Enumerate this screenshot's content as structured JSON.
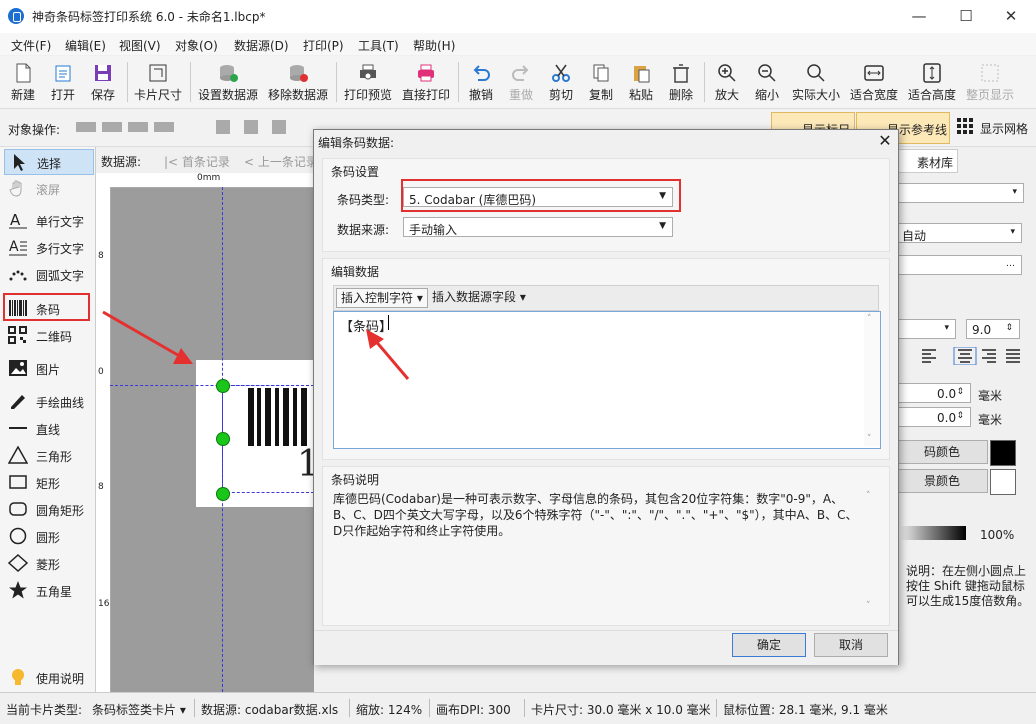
{
  "window": {
    "title": "神奇条码标签打印系统 6.0 - 未命名1.lbcp*",
    "min": "—",
    "max": "☐",
    "close": "✕"
  },
  "menu": [
    "文件(F)",
    "编辑(E)",
    "视图(V)",
    "对象(O)",
    "数据源(D)",
    "打印(P)",
    "工具(T)",
    "帮助(H)"
  ],
  "toolbar": {
    "new": "新建",
    "open": "打开",
    "save": "保存",
    "card_size": "卡片尺寸",
    "set_datasource": "设置数据源",
    "remove_datasource": "移除数据源",
    "print_preview": "打印预览",
    "direct_print": "直接打印",
    "undo": "撤销",
    "redo": "重做",
    "cut": "剪切",
    "copy": "复制",
    "paste": "粘贴",
    "delete": "删除",
    "zoom_in": "放大",
    "zoom_out": "缩小",
    "actual_size": "实际大小",
    "fit_width": "适合宽度",
    "fit_height": "适合高度",
    "full_page": "整页显示"
  },
  "objbar": {
    "label": "对象操作:",
    "show_ruler": "显示标尺",
    "show_guides": "显示参考线",
    "show_grid": "显示网格"
  },
  "tools": {
    "select": "选择",
    "scroll": "滚屏",
    "single_text": "单行文字",
    "multi_text": "多行文字",
    "arc_text": "圆弧文字",
    "barcode": "条码",
    "qrcode": "二维码",
    "image": "图片",
    "freehand": "手绘曲线",
    "line": "直线",
    "triangle": "三角形",
    "rect": "矩形",
    "round_rect": "圆角矩形",
    "ellipse": "圆形",
    "diamond": "菱形",
    "star": "五角星",
    "help": "使用说明"
  },
  "canvas_bar": {
    "label": "数据源:",
    "first": "首条记录",
    "prev": "上一条记录"
  },
  "ruler": {
    "zero": "0mm",
    "n8": "8",
    "n16": "16",
    "n0": "0",
    "v8": "8",
    "v16": "16"
  },
  "barcode_digit": "1",
  "right_panel": {
    "tab": "素材库",
    "auto": "自动",
    "font_size": "9.0",
    "val1": "0.0",
    "val2": "0.0",
    "unit": "毫米",
    "barcode_color": "码颜色",
    "bg_color": "景颜色",
    "opacity": "100%",
    "hint": "说明：在左侧小圆点上按住 Shift 键拖动鼠标可以生成15度倍数角。"
  },
  "dialog": {
    "title": "编辑条码数据:",
    "settings_group": "条码设置",
    "type_label": "条码类型:",
    "type_value": "5.  Codabar (库德巴码)",
    "source_label": "数据来源:",
    "source_value": "手动输入",
    "edit_group": "编辑数据",
    "insert_ctrl": "插入控制字符",
    "insert_field": "插入数据源字段",
    "data_text": "【条码】",
    "desc_group": "条码说明",
    "desc_text": "库德巴码(Codabar)是一种可表示数字、字母信息的条码，其包含20位字符集：数字\"0-9\"，A、B、C、D四个英文大写字母，以及6个特殊字符（\"-\"、\":\"、\"/\"、\".\"、\"+\"、\"$\"），其中A、B、C、D只作起始字符和终止字符使用。",
    "ok": "确定",
    "cancel": "取消"
  },
  "status": {
    "card_type_label": "当前卡片类型:",
    "card_type": "条码标签类卡片",
    "datasource": "数据源: codabar数据.xls",
    "zoom": "缩放: 124%",
    "dpi": "画布DPI: 300",
    "card_size": "卡片尺寸: 30.0 毫米 x 10.0 毫米",
    "mouse_pos": "鼠标位置: 28.1 毫米, 9.1 毫米"
  },
  "colors": {
    "accent": "#1c6fd1",
    "highlight": "#e03030",
    "handle": "#19c619"
  }
}
